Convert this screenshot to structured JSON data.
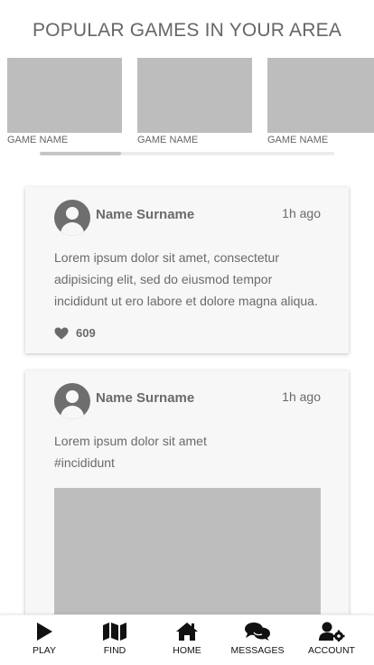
{
  "header": {
    "title": "POPULAR GAMES IN YOUR AREA"
  },
  "games": [
    {
      "name": "GAME NAME"
    },
    {
      "name": "GAME NAME"
    },
    {
      "name": "GAME NAME"
    }
  ],
  "posts": [
    {
      "author": "Name Surname",
      "time": "1h ago",
      "text": "Lorem ipsum dolor sit amet, consectetur adipisicing elit, sed do eiusmod tempor incididunt ut ero labore et dolore magna aliqua.",
      "likes": "609"
    },
    {
      "author": "Name Surname",
      "time": "1h ago",
      "text_line1": "Lorem ipsum dolor sit amet",
      "text_line2": "#incididunt"
    }
  ],
  "nav": {
    "items": [
      {
        "label": "PLAY",
        "icon": "play-icon"
      },
      {
        "label": "FIND",
        "icon": "map-icon"
      },
      {
        "label": "HOME",
        "icon": "home-icon"
      },
      {
        "label": "MESSAGES",
        "icon": "comments-icon"
      },
      {
        "label": "ACCOUNT",
        "icon": "user-cog-icon"
      }
    ]
  },
  "colors": {
    "placeholder": "#bdbdbd",
    "card_bg": "#f7f7f7",
    "text": "#6a6a6a",
    "icon": "#111111"
  }
}
